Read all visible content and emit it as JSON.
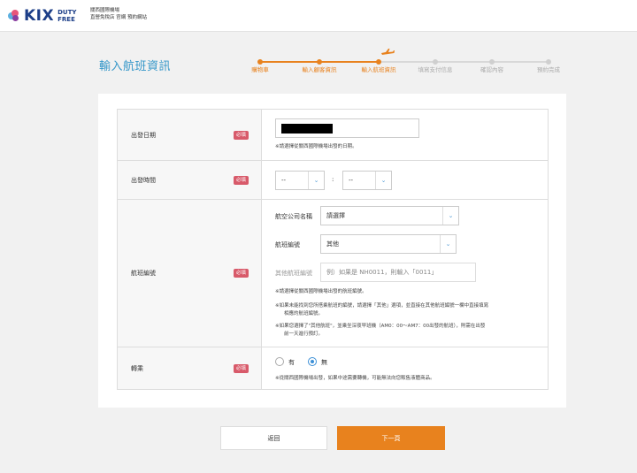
{
  "header": {
    "logo_text": "KIX",
    "logo_sub1": "DUTY",
    "logo_sub2": "FREE",
    "line1": "關西國際機場",
    "line2": "直營免稅店 官網 預約網站"
  },
  "page_title": "輸入航班資訊",
  "steps": [
    {
      "label": "購物車",
      "state": "done"
    },
    {
      "label": "輸入顧客資訊",
      "state": "done"
    },
    {
      "label": "輸入航班資訊",
      "state": "current"
    },
    {
      "label": "填寫支付信息",
      "state": "todo"
    },
    {
      "label": "確認內容",
      "state": "todo"
    },
    {
      "label": "預約完成",
      "state": "todo"
    }
  ],
  "form": {
    "required_badge": "必填",
    "date": {
      "label": "出發日期",
      "value": "",
      "note": "※請選擇從關西國際機場出發的日期。"
    },
    "time": {
      "label": "出發時間",
      "hour": "--",
      "minute": "--",
      "separator": ":"
    },
    "flight": {
      "label": "航班編號",
      "airline_label": "航空公司名稱",
      "airline_value": "請選擇",
      "flight_no_label": "航班編號",
      "flight_no_value": "其他",
      "other_label": "其他航班編號",
      "other_placeholder": "例）如果是 NH0011，則輸入「0011」",
      "note1": "※請選擇從關西國際機場出發的航班編號。",
      "note2a": "※如果未能找到您所搭乘航班的編號，請選擇「其他」選項，並直接在其他航班編號一欄中直接填寫",
      "note2b": "相應的航班編號。",
      "note3a": "※如果您選擇了\"其他航班\"，並乘坐深夜早班機（AM0：00～AM7：00出發的航班），則需在出發",
      "note3b": "前一天進行預訂。"
    },
    "transfer": {
      "label": "轉乘",
      "yes": "有",
      "no": "無",
      "selected": "無",
      "note": "※從關西國際機場出發，如果中途需要轉機，可能無法向您販售液體商品。"
    }
  },
  "buttons": {
    "back": "返回",
    "next": "下一頁"
  },
  "colors": {
    "accent": "#e8821e",
    "title": "#3597c9",
    "brand": "#1c3e88",
    "required": "#d85a6a",
    "inactive": "#cfcfcf"
  }
}
